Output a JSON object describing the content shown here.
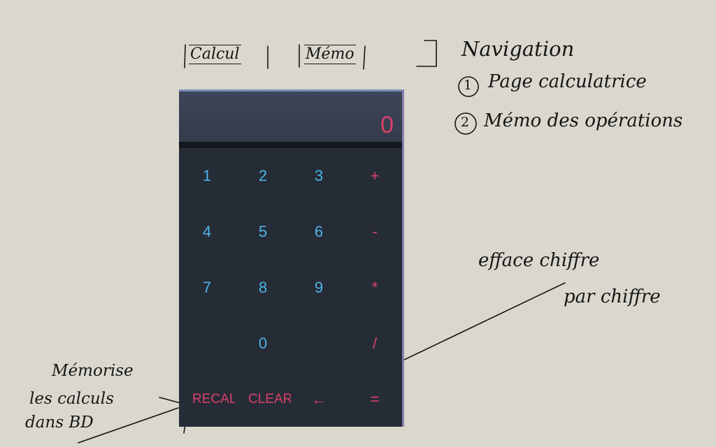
{
  "nav": {
    "tabs": [
      {
        "label": "Calcul"
      },
      {
        "label": "Mémo"
      }
    ]
  },
  "annotations": {
    "navigation_title": "Navigation",
    "nav_item_1_number": "1",
    "nav_item_1_text": "Page calculatrice",
    "nav_item_2_number": "2",
    "nav_item_2_text": "Mémo des opérations",
    "backspace_note_line1": "efface chiffre",
    "backspace_note_line2": "par chiffre",
    "recall_note_line1": "Mémorise",
    "recall_note_line2": "les calculs",
    "recall_note_line3": "dans BD"
  },
  "calculator": {
    "display": "0",
    "keys": [
      {
        "label": "1",
        "kind": "digit"
      },
      {
        "label": "2",
        "kind": "digit"
      },
      {
        "label": "3",
        "kind": "digit"
      },
      {
        "label": "+",
        "kind": "op"
      },
      {
        "label": "4",
        "kind": "digit"
      },
      {
        "label": "5",
        "kind": "digit"
      },
      {
        "label": "6",
        "kind": "digit"
      },
      {
        "label": "-",
        "kind": "op"
      },
      {
        "label": "7",
        "kind": "digit"
      },
      {
        "label": "8",
        "kind": "digit"
      },
      {
        "label": "9",
        "kind": "digit"
      },
      {
        "label": "*",
        "kind": "op"
      },
      {
        "label": "",
        "kind": "empty"
      },
      {
        "label": "0",
        "kind": "digit"
      },
      {
        "label": "",
        "kind": "empty"
      },
      {
        "label": "/",
        "kind": "op"
      },
      {
        "label": "RECAL",
        "kind": "fn"
      },
      {
        "label": "CLEAR",
        "kind": "fn"
      },
      {
        "label": "←",
        "kind": "op"
      },
      {
        "label": "=",
        "kind": "op"
      }
    ]
  },
  "colors": {
    "background": "#dad8ce",
    "calculator_body": "#262c36",
    "display_bg": "#3d4659",
    "digit": "#4db4ea",
    "operator": "#d8416a",
    "ink": "#151515"
  }
}
